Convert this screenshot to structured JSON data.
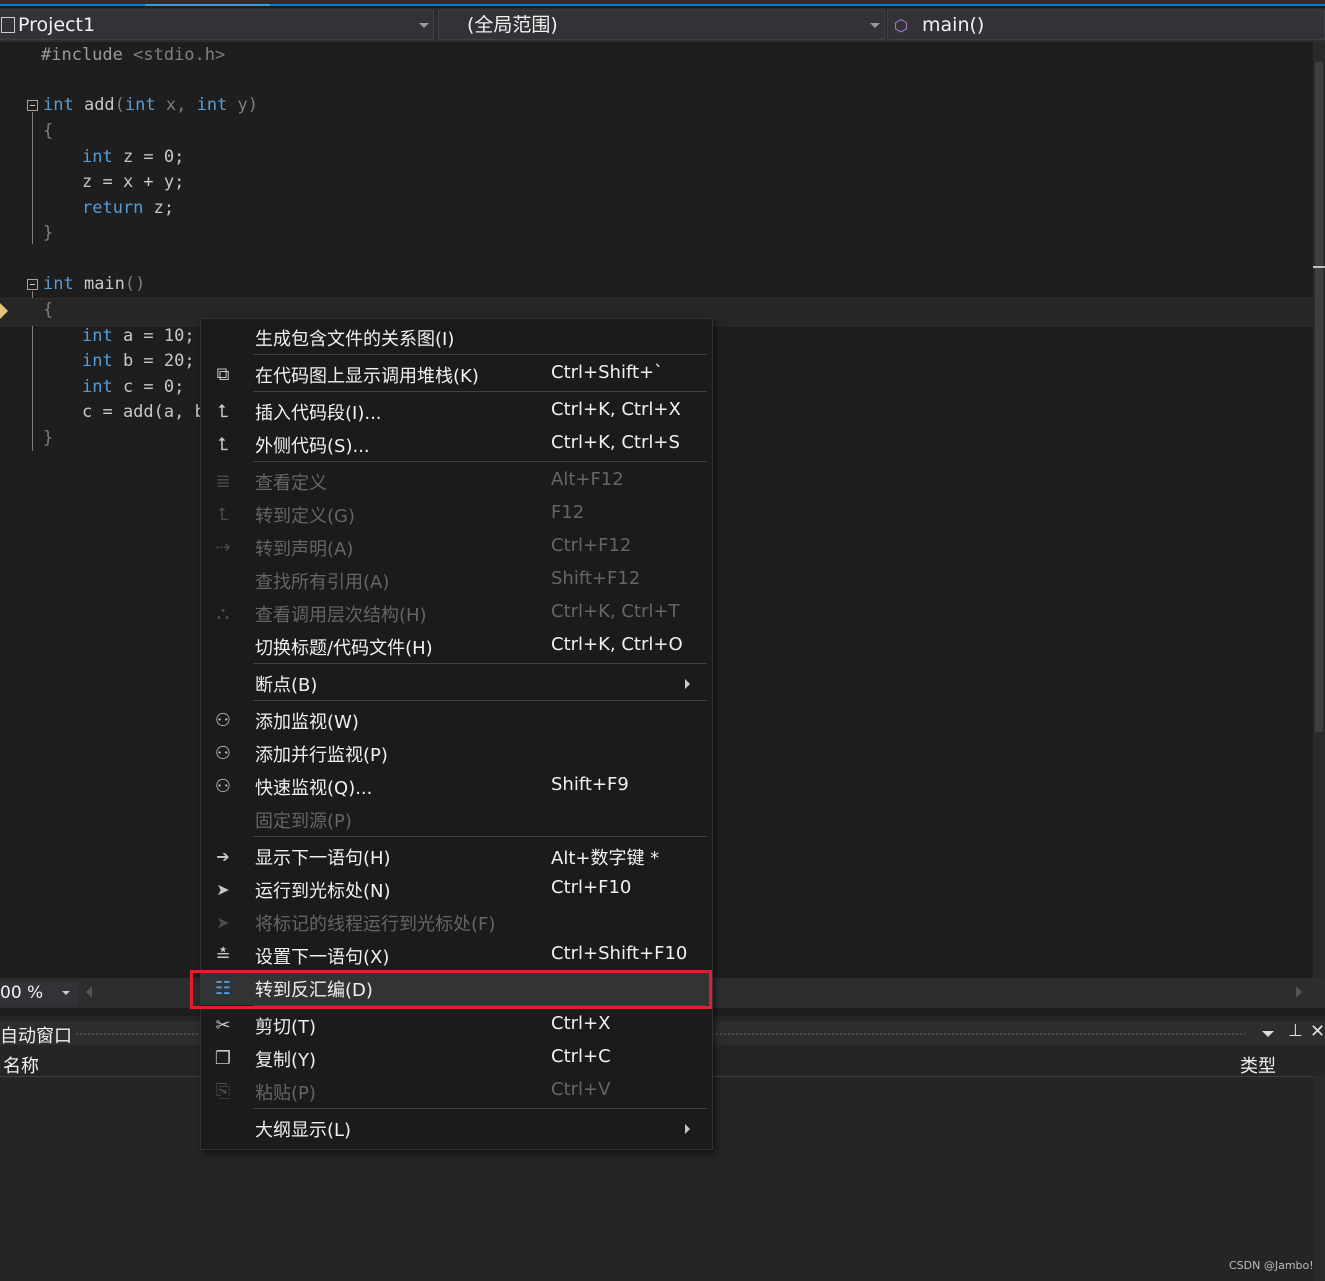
{
  "navbar": {
    "project": "Project1",
    "scope": "(全局范围)",
    "function": "main()"
  },
  "code": {
    "include_hash": "#include ",
    "include_file": "<stdio.h>",
    "add_sig": [
      "int",
      " add",
      "(",
      "int",
      " x, ",
      "int",
      " y",
      ")"
    ],
    "main_sig": [
      "int",
      " main",
      "()"
    ],
    "brace_open": "{",
    "brace_close": "}",
    "line_int_z": "int",
    "line_z_rest": " z = 0;",
    "line_z_assign": "z = x + y;",
    "line_return": "return",
    "line_return_rest": " z;",
    "line_a": " a = 10;",
    "line_b": " b = 20;",
    "line_c": " c = 0;",
    "line_call": "c = add(a, b",
    "kw_int": "int"
  },
  "editor_status": {
    "zoom": "00 %"
  },
  "auto_window": {
    "title": "自动窗口",
    "col_name": "名称",
    "col_type": "类型"
  },
  "watermark": "CSDN @Jambo!",
  "context_menu": {
    "items": [
      {
        "label": "生成包含文件的关系图(I)",
        "shortcut": "",
        "icon": "none",
        "disabled": false
      },
      {
        "label": "在代码图上显示调用堆栈(K)",
        "shortcut": "Ctrl+Shift+`",
        "icon": "code-map-icon",
        "disabled": false
      },
      {
        "label": "插入代码段(I)...",
        "shortcut": "Ctrl+K, Ctrl+X",
        "icon": "insert-snippet-icon",
        "disabled": false
      },
      {
        "label": "外侧代码(S)...",
        "shortcut": "Ctrl+K, Ctrl+S",
        "icon": "surround-with-icon",
        "disabled": false
      },
      {
        "label": "查看定义",
        "shortcut": "Alt+F12",
        "icon": "peek-definition-icon",
        "disabled": true
      },
      {
        "label": "转到定义(G)",
        "shortcut": "F12",
        "icon": "goto-definition-icon",
        "disabled": true
      },
      {
        "label": "转到声明(A)",
        "shortcut": "Ctrl+F12",
        "icon": "goto-declaration-icon",
        "disabled": true
      },
      {
        "label": "查找所有引用(A)",
        "shortcut": "Shift+F12",
        "icon": "none",
        "disabled": true
      },
      {
        "label": "查看调用层次结构(H)",
        "shortcut": "Ctrl+K, Ctrl+T",
        "icon": "call-hierarchy-icon",
        "disabled": true
      },
      {
        "label": "切换标题/代码文件(H)",
        "shortcut": "Ctrl+K, Ctrl+O",
        "icon": "none",
        "disabled": false
      },
      {
        "label": "断点(B)",
        "shortcut": "",
        "icon": "none",
        "disabled": false,
        "submenu": true
      },
      {
        "label": "添加监视(W)",
        "shortcut": "",
        "icon": "watch-icon",
        "disabled": false
      },
      {
        "label": "添加并行监视(P)",
        "shortcut": "",
        "icon": "parallel-watch-icon",
        "disabled": false
      },
      {
        "label": "快速监视(Q)...",
        "shortcut": "Shift+F9",
        "icon": "quick-watch-icon",
        "disabled": false
      },
      {
        "label": "固定到源(P)",
        "shortcut": "",
        "icon": "none",
        "disabled": true
      },
      {
        "label": "显示下一语句(H)",
        "shortcut": "Alt+数字键 *",
        "icon": "arrow-right-icon",
        "disabled": false
      },
      {
        "label": "运行到光标处(N)",
        "shortcut": "Ctrl+F10",
        "icon": "cursor-icon",
        "disabled": false
      },
      {
        "label": "将标记的线程运行到光标处(F)",
        "shortcut": "",
        "icon": "cursor-icon",
        "disabled": true
      },
      {
        "label": "设置下一语句(X)",
        "shortcut": "Ctrl+Shift+F10",
        "icon": "set-next-statement-icon",
        "disabled": false
      },
      {
        "label": "转到反汇编(D)",
        "shortcut": "",
        "icon": "disassembly-icon",
        "disabled": false,
        "highlighted": true
      },
      {
        "label": "剪切(T)",
        "shortcut": "Ctrl+X",
        "icon": "scissors-icon",
        "disabled": false
      },
      {
        "label": "复制(Y)",
        "shortcut": "Ctrl+C",
        "icon": "copy-icon",
        "disabled": false
      },
      {
        "label": "粘贴(P)",
        "shortcut": "Ctrl+V",
        "icon": "paste-icon",
        "disabled": true
      },
      {
        "label": "大纲显示(L)",
        "shortcut": "",
        "icon": "none",
        "disabled": false,
        "submenu": true
      }
    ]
  },
  "colors": {
    "highlight_border": "#e0202c",
    "keyword": "#569cd6",
    "accent": "#007acc"
  }
}
